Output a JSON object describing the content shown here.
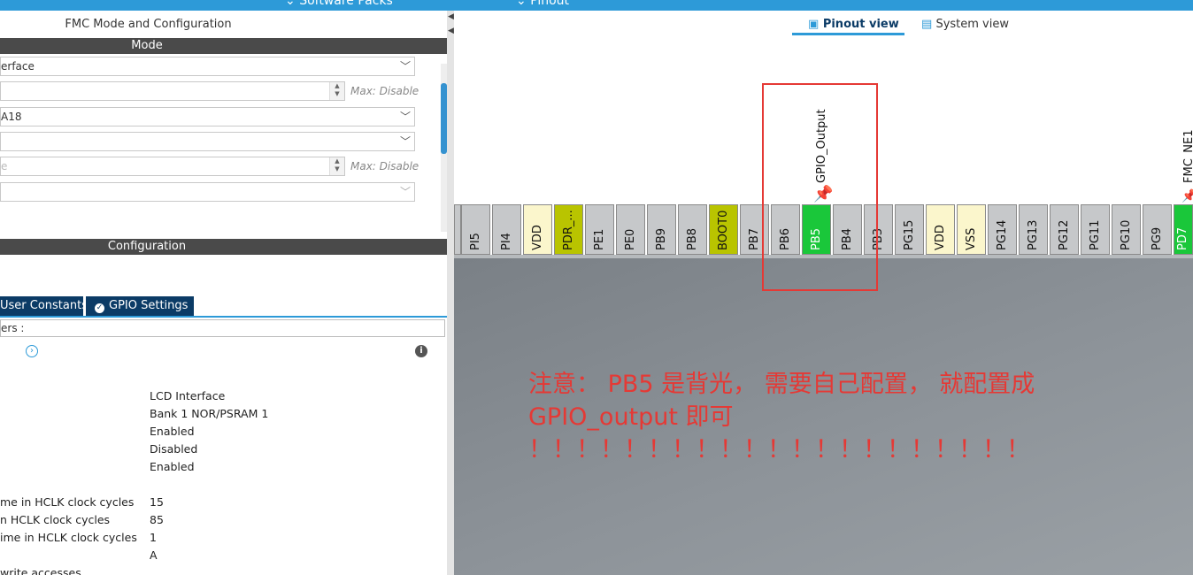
{
  "topbar": {
    "software_packs": "Software Packs",
    "pinout": "Pinout"
  },
  "left_panel": {
    "title": "FMC Mode and Configuration",
    "mode_label": "Mode",
    "mode_fields": [
      {
        "text": "erface"
      },
      {
        "text": "",
        "max": "Max: Disable"
      },
      {
        "text": "A18"
      },
      {
        "text": ""
      },
      {
        "text": "e",
        "max": "Max: Disable"
      },
      {
        "text": ""
      }
    ],
    "configuration_label": "Configuration",
    "tabs": {
      "user_constants": "User Constants",
      "gpio_settings": "GPIO Settings"
    },
    "search_text": "ers :",
    "params": [
      {
        "name": "",
        "value": "LCD Interface"
      },
      {
        "name": "",
        "value": "Bank 1 NOR/PSRAM 1"
      },
      {
        "name": "",
        "value": "Enabled"
      },
      {
        "name": "",
        "value": "Disabled"
      },
      {
        "name": "",
        "value": "Enabled"
      },
      {
        "name": "me in HCLK clock cycles",
        "value": "15"
      },
      {
        "name": "n HCLK clock cycles",
        "value": "85"
      },
      {
        "name": "ime in HCLK clock cycles",
        "value": "1"
      },
      {
        "name": "",
        "value": "A"
      },
      {
        "name": "write accesses",
        "value": ""
      }
    ]
  },
  "right_panel": {
    "tabs": {
      "pinout_view": "Pinout view",
      "system_view": "System view"
    },
    "pins": [
      "PI5",
      "PI4",
      "VDD",
      "PDR_...",
      "PE1",
      "PE0",
      "PB9",
      "PB8",
      "BOOT0",
      "PB7",
      "PB6",
      "PB5",
      "PB4",
      "PB3",
      "PG15",
      "VDD",
      "VSS",
      "PG14",
      "PG13",
      "PG12",
      "PG11",
      "PG10",
      "PG9",
      "PD7"
    ],
    "pin_labels": {
      "pb5": "GPIO_Output",
      "pd7": "FMC_NE1"
    },
    "annotation": {
      "line1": "注意： PB5 是背光， 需要自己配置， 就配置成",
      "line2": "GPIO_output 即可",
      "line3": "！！！！！！！！！！！！！！！！！！！！！"
    }
  },
  "colors": {
    "accent": "#2d9ad8",
    "tab_dark": "#0b3b66",
    "pin_green": "#1ac73a",
    "highlight_red": "#e53935"
  }
}
